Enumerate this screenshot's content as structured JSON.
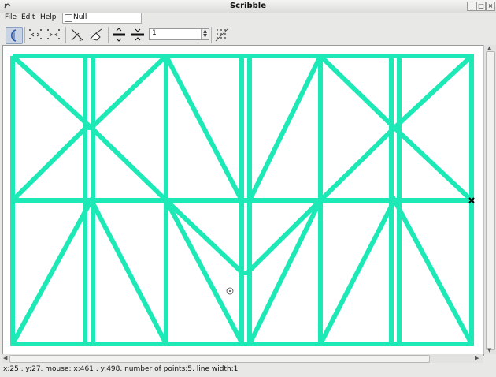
{
  "window": {
    "title": "Scribble"
  },
  "menubar": {
    "items": [
      "File",
      "Edit",
      "Help"
    ]
  },
  "null_toggle": {
    "label": "Null"
  },
  "toolbar": {
    "line_width_value": "1"
  },
  "drawing": {
    "stroke_color": "#1de9b6",
    "stroke_width": 6,
    "selected_point_marker": "x-marker-icon",
    "cursor": "crosshair-cursor-icon"
  },
  "status": {
    "text": "x:25 , y:27, mouse: x:461 , y:498, number of points:5, line width:1"
  }
}
